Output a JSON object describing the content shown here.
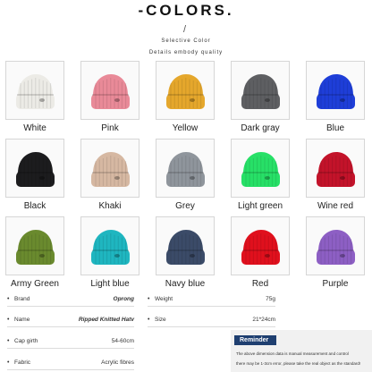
{
  "header": {
    "title": "-COLORS.",
    "divider": "/",
    "subtitle_1": "Selective Color",
    "subtitle_2": "Details embody quality"
  },
  "colors": [
    {
      "name": "White",
      "hex": "#ecebe6"
    },
    {
      "name": "Pink",
      "hex": "#e98a98"
    },
    {
      "name": "Yellow",
      "hex": "#e5a72c"
    },
    {
      "name": "Dark gray",
      "hex": "#5e5f62"
    },
    {
      "name": "Blue",
      "hex": "#1e3ed8"
    },
    {
      "name": "Black",
      "hex": "#1c1c1e"
    },
    {
      "name": "Khaki",
      "hex": "#d6b8a2"
    },
    {
      "name": "Grey",
      "hex": "#8f959c"
    },
    {
      "name": "Light green",
      "hex": "#27e067"
    },
    {
      "name": "Wine red",
      "hex": "#c3132a"
    },
    {
      "name": "Army Green",
      "hex": "#6a8a2e"
    },
    {
      "name": "Light blue",
      "hex": "#1fb6c0"
    },
    {
      "name": "Navy blue",
      "hex": "#3b4b68"
    },
    {
      "name": "Red",
      "hex": "#e0101d"
    },
    {
      "name": "Purple",
      "hex": "#8d5fc4"
    }
  ],
  "specs": {
    "brand_label": "Brand",
    "brand_value": "Oprong",
    "weight_label": "Weight",
    "weight_value": "75g",
    "name_label": "Name",
    "name_value": "Ripped Knitted Hatv",
    "size_label": "Size",
    "size_value": "21*24cm",
    "girth_label": "Cap girth",
    "girth_value": "54-60cm",
    "fabric_label": "Fabric",
    "fabric_value": "Acrylic fibres",
    "bullet": "•"
  },
  "reminder": {
    "badge": "Reminder",
    "line_1": "The above dimension data is manual measurement and control",
    "line_2": "there may be 1-3cm error, please take the real object as the standard!"
  }
}
